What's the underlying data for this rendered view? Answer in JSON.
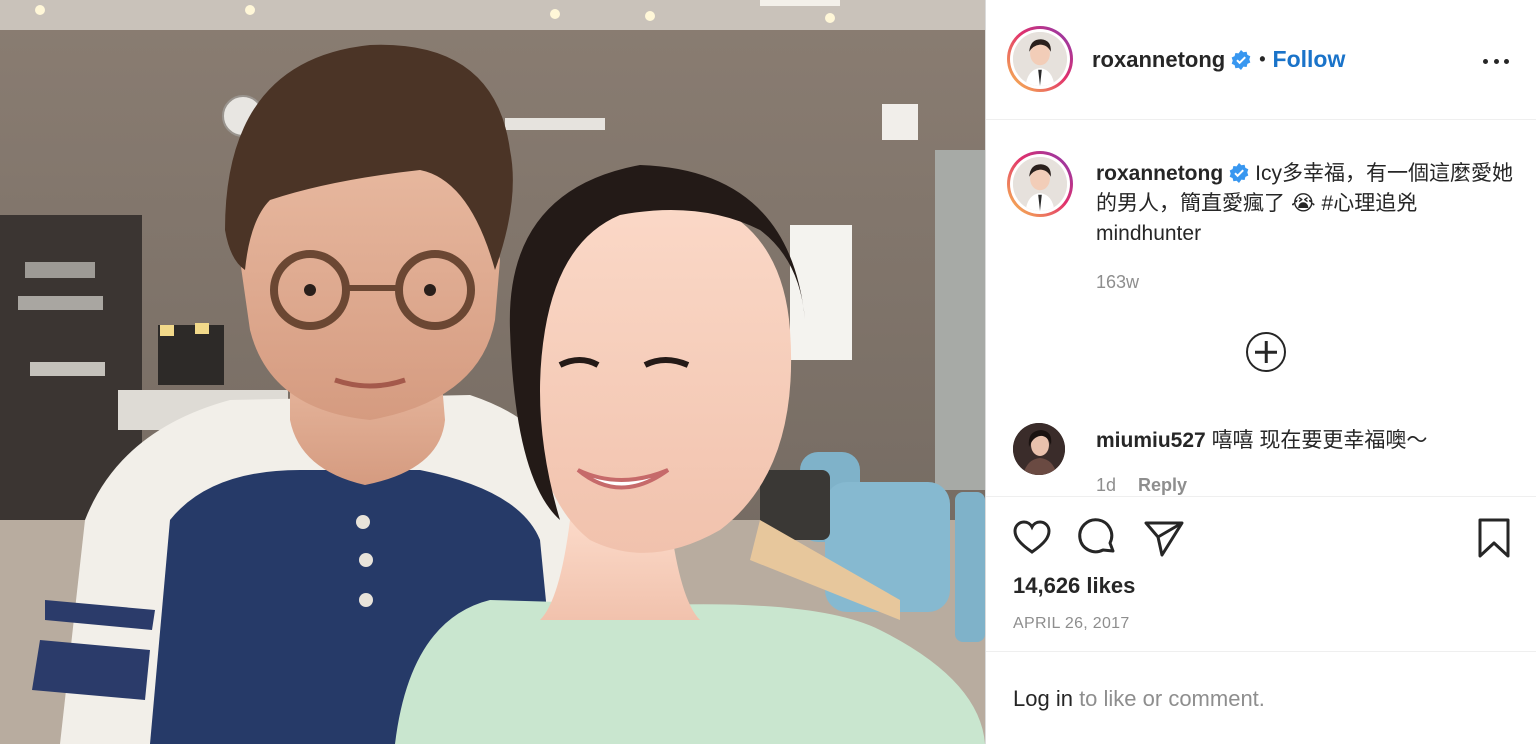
{
  "post": {
    "author": "roxannetong",
    "follow_label": "Follow",
    "separator": "•"
  },
  "caption": {
    "username": "roxannetong",
    "text": "Icy多幸福，有一個這麼愛她的男人，簡直愛瘋了",
    "emoji": "😭",
    "hashtags": "#心理追兇 mindhunter",
    "time": "163w"
  },
  "comment": {
    "username": "miumiu527",
    "text": "嘻嘻 现在要更幸福噢～",
    "time": "1d",
    "reply_label": "Reply"
  },
  "actions": {
    "likes": "14,626 likes",
    "date": "APRIL 26, 2017"
  },
  "login": {
    "link_text": "Log in",
    "rest_text": " to like or comment."
  },
  "colors": {
    "follow": "#1a73c9",
    "verified": "#3897f0",
    "text": "#262626",
    "muted": "#8e8e8e"
  },
  "icons": [
    "verified-badge-icon",
    "more-options-icon",
    "load-more-comments-icon",
    "heart-icon",
    "comment-icon",
    "share-icon",
    "bookmark-icon"
  ]
}
